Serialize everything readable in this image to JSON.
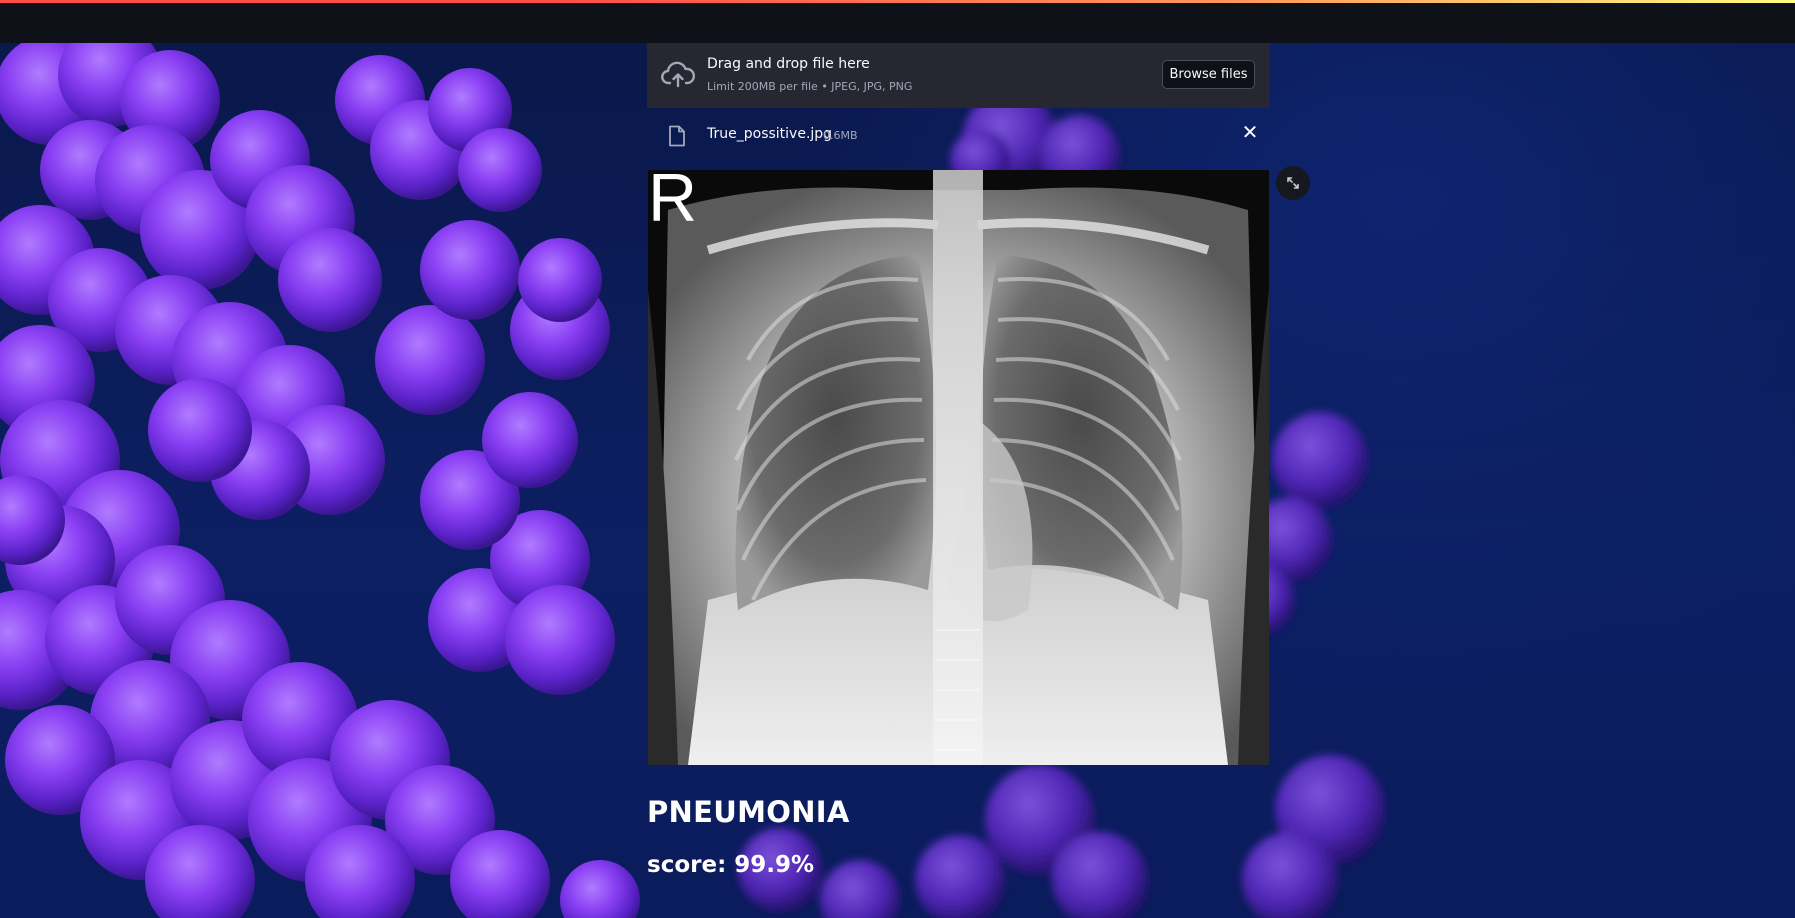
{
  "uploader": {
    "title": "Drag and drop file here",
    "subtitle": "Limit 200MB per file • JPEG, JPG, PNG",
    "browse_label": "Browse files",
    "icon": "cloud-upload-icon"
  },
  "file": {
    "name": "True_possitive.jpg",
    "size": "0.6MB",
    "icon": "file-icon",
    "close_icon": "close-icon",
    "close_glyph": "✕"
  },
  "image": {
    "marker": "R",
    "fullscreen_icon": "fullscreen-icon"
  },
  "result": {
    "label": "PNEUMONIA",
    "score": "score: 99.9%"
  },
  "colors": {
    "background": "#0b1a55",
    "bacteria": "#7a3cf0",
    "header": "#0e1117",
    "uploader_bg": "#262730",
    "accent": "#ff4b4b"
  }
}
